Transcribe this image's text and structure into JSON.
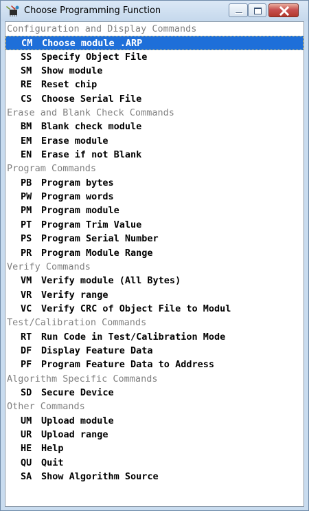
{
  "window": {
    "title": "Choose Programming Function",
    "icon": "chip-wrench-icon",
    "controls": [
      "minimize-icon",
      "maximize-icon",
      "close-icon"
    ],
    "colors": {
      "selection": "#1e6fd9",
      "header_text": "#808080",
      "close_button": "#c75050"
    }
  },
  "sections": [
    {
      "header": "Configuration and Display Commands",
      "items": [
        {
          "code": "CM",
          "label": "Choose module .ARP",
          "selected": true
        },
        {
          "code": "SS",
          "label": "Specify Object File"
        },
        {
          "code": "SM",
          "label": "Show module"
        },
        {
          "code": "RE",
          "label": "Reset chip"
        },
        {
          "code": "CS",
          "label": "Choose Serial File"
        }
      ]
    },
    {
      "header": "Erase and Blank Check Commands",
      "items": [
        {
          "code": "BM",
          "label": "Blank check module"
        },
        {
          "code": "EM",
          "label": "Erase module"
        },
        {
          "code": "EN",
          "label": "Erase if not Blank"
        }
      ]
    },
    {
      "header": "Program Commands",
      "items": [
        {
          "code": "PB",
          "label": "Program bytes"
        },
        {
          "code": "PW",
          "label": "Program words"
        },
        {
          "code": "PM",
          "label": "Program module"
        },
        {
          "code": "PT",
          "label": "Program Trim Value"
        },
        {
          "code": "PS",
          "label": "Program Serial Number"
        },
        {
          "code": "PR",
          "label": "Program Module Range"
        }
      ]
    },
    {
      "header": "Verify Commands",
      "items": [
        {
          "code": "VM",
          "label": "Verify module (All Bytes)"
        },
        {
          "code": "VR",
          "label": "Verify range"
        },
        {
          "code": "VC",
          "label": "Verify CRC of Object File to Modul"
        }
      ]
    },
    {
      "header": "Test/Calibration Commands",
      "items": [
        {
          "code": "RT",
          "label": "Run Code in Test/Calibration Mode"
        },
        {
          "code": "DF",
          "label": "Display Feature Data"
        },
        {
          "code": "PF",
          "label": "Program Feature Data to Address"
        }
      ]
    },
    {
      "header": "Algorithm Specific Commands",
      "items": [
        {
          "code": "SD",
          "label": "Secure Device"
        }
      ]
    },
    {
      "header": "Other Commands",
      "items": [
        {
          "code": "UM",
          "label": "Upload module"
        },
        {
          "code": "UR",
          "label": "Upload range"
        },
        {
          "code": "HE",
          "label": "Help"
        },
        {
          "code": "QU",
          "label": "Quit"
        },
        {
          "code": "SA",
          "label": "Show Algorithm Source"
        }
      ]
    }
  ]
}
